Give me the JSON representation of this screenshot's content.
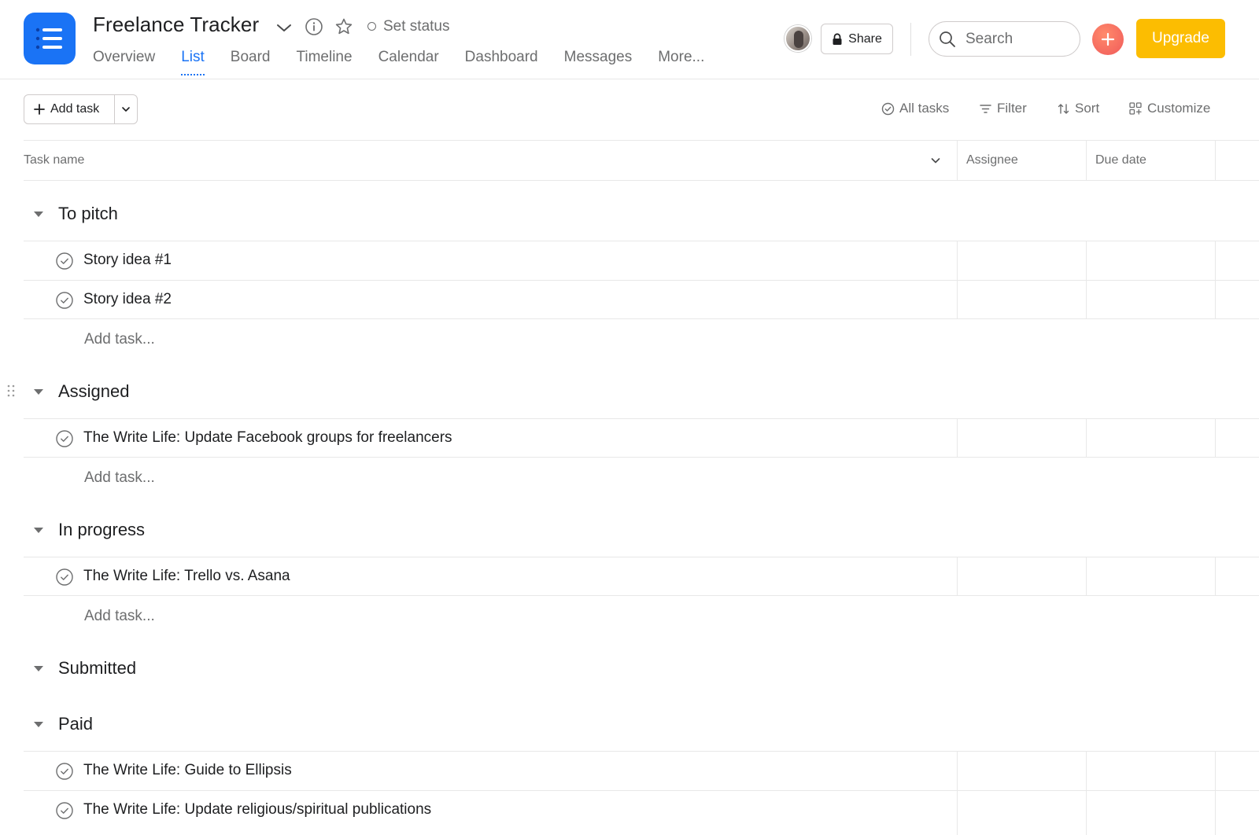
{
  "header": {
    "project_title": "Freelance Tracker",
    "set_status": "Set status",
    "tabs": [
      {
        "label": "Overview",
        "active": false
      },
      {
        "label": "List",
        "active": true
      },
      {
        "label": "Board",
        "active": false
      },
      {
        "label": "Timeline",
        "active": false
      },
      {
        "label": "Calendar",
        "active": false
      },
      {
        "label": "Dashboard",
        "active": false
      },
      {
        "label": "Messages",
        "active": false
      },
      {
        "label": "More...",
        "active": false
      }
    ],
    "share_label": "Share",
    "search_placeholder": "Search",
    "upgrade_label": "Upgrade"
  },
  "toolbar": {
    "add_task_label": "Add task",
    "all_tasks_label": "All tasks",
    "filter_label": "Filter",
    "sort_label": "Sort",
    "customize_label": "Customize"
  },
  "columns": {
    "task_name": "Task name",
    "assignee": "Assignee",
    "due_date": "Due date"
  },
  "sections": [
    {
      "name": "To pitch",
      "tasks": [
        "Story idea #1",
        "Story idea #2"
      ],
      "add_task": "Add task..."
    },
    {
      "name": "Assigned",
      "tasks": [
        "The Write Life: Update Facebook groups for freelancers"
      ],
      "add_task": "Add task..."
    },
    {
      "name": "In progress",
      "tasks": [
        "The Write Life: Trello vs. Asana"
      ],
      "add_task": "Add task..."
    },
    {
      "name": "Submitted",
      "tasks": [],
      "add_task": ""
    },
    {
      "name": "Paid",
      "tasks": [
        "The Write Life: Guide to Ellipsis",
        "The Write Life: Update religious/spiritual publications"
      ],
      "add_task": ""
    }
  ],
  "colors": {
    "accent": "#1a73f5",
    "upgrade": "#fcbd01",
    "add_button": "#f05a5a",
    "muted_text": "#6d6e6f"
  }
}
